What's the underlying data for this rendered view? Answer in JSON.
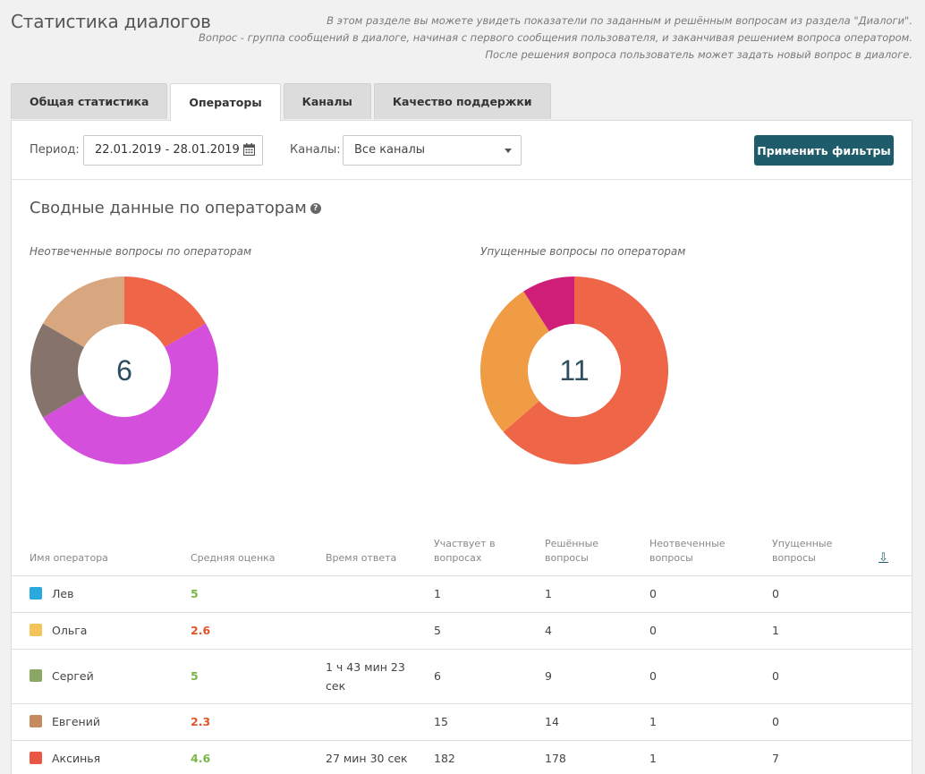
{
  "page": {
    "title": "Статистика диалогов",
    "intro": [
      "В этом разделе вы можете увидеть показатели по заданным и решённым вопросам из раздела \"Диалоги\".",
      "Вопрос - группа сообщений в диалоге, начиная с первого сообщения пользователя, и заканчивая решением вопроса оператором.",
      "После решения вопроса пользователь может задать новый вопрос в диалоге."
    ]
  },
  "tabs": [
    {
      "label": "Общая статистика",
      "active": false
    },
    {
      "label": "Операторы",
      "active": true
    },
    {
      "label": "Каналы",
      "active": false
    },
    {
      "label": "Качество поддержки",
      "active": false
    }
  ],
  "filters": {
    "period_label": "Период:",
    "period_value": "22.01.2019 - 28.01.2019",
    "channels_label": "Каналы:",
    "channels_value": "Все каналы",
    "apply_label": "Применить фильтры"
  },
  "summary": {
    "title": "Сводные данные по операторам",
    "help_icon": "question-circle-icon"
  },
  "chart_data": [
    {
      "type": "pie",
      "title": "Неотвеченные вопросы по операторам",
      "total": "6",
      "slices": [
        {
          "value": 1,
          "color": "#ef6548"
        },
        {
          "value": 3,
          "color": "#d44fdb"
        },
        {
          "value": 1,
          "color": "#85736c"
        },
        {
          "value": 1,
          "color": "#d8a780"
        }
      ]
    },
    {
      "type": "pie",
      "title": "Упущенные вопросы по операторам",
      "total": "11",
      "slices": [
        {
          "value": 7,
          "color": "#ef6548"
        },
        {
          "value": 3,
          "color": "#ef9c44"
        },
        {
          "value": 1,
          "color": "#cf1e78"
        }
      ]
    }
  ],
  "table": {
    "headers": {
      "name": "Имя оператора",
      "rating": "Средняя оценка",
      "response": "Время ответа",
      "participates": [
        "Участвует в",
        "вопросах"
      ],
      "solved": [
        "Решённые",
        "вопросы"
      ],
      "unanswered": [
        "Неотвеченные",
        "вопросы"
      ],
      "missed": [
        "Упущенные",
        "вопросы"
      ],
      "sort_icon": "download-arrow-icon"
    },
    "rows": [
      {
        "name": "Лев",
        "color": "#29a8de",
        "rating": "5",
        "rating_color": "#7ab648",
        "response": "",
        "participates": "1",
        "solved": "1",
        "unanswered": "0",
        "missed": "0"
      },
      {
        "name": "Ольга",
        "color": "#f2c45a",
        "rating": "2.6",
        "rating_color": "#e0552b",
        "response": "",
        "participates": "5",
        "solved": "4",
        "unanswered": "0",
        "missed": "1"
      },
      {
        "name": "Сергей",
        "color": "#8aa864",
        "rating": "5",
        "rating_color": "#7ab648",
        "response": "1 ч 43 мин 23 сек",
        "participates": "6",
        "solved": "9",
        "unanswered": "0",
        "missed": "0"
      },
      {
        "name": "Евгений",
        "color": "#c58a5f",
        "rating": "2.3",
        "rating_color": "#e0552b",
        "response": "",
        "participates": "15",
        "solved": "14",
        "unanswered": "1",
        "missed": "0"
      },
      {
        "name": "Аксинья",
        "color": "#ea5644",
        "rating": "4.6",
        "rating_color": "#7ab648",
        "response": "27 мин 30 сек",
        "participates": "182",
        "solved": "178",
        "unanswered": "1",
        "missed": "7"
      }
    ]
  }
}
